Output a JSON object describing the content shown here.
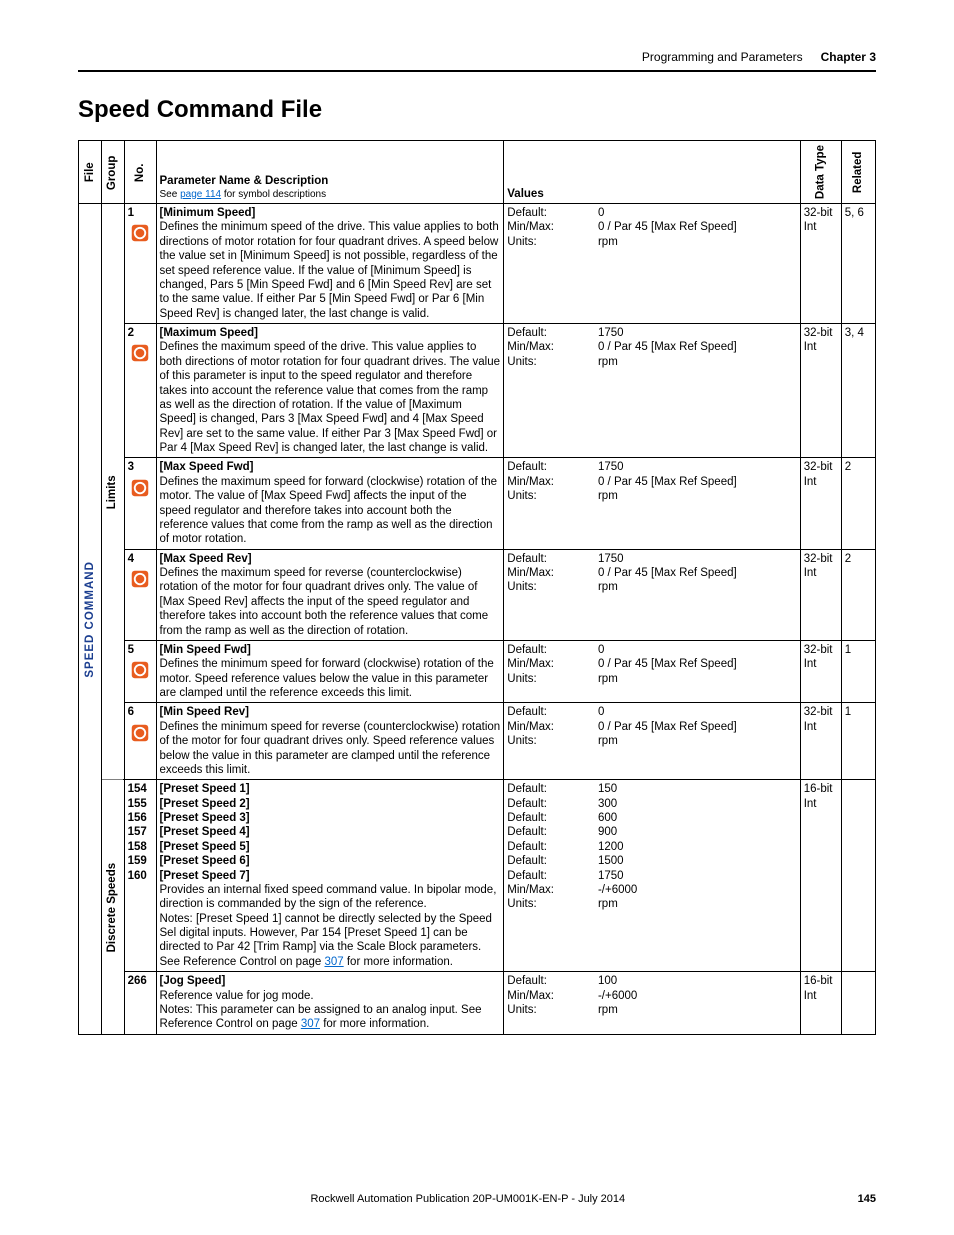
{
  "header": {
    "chapterTitle": "Programming and Parameters",
    "chapterLabel": "Chapter 3"
  },
  "sectionTitle": "Speed Command File",
  "tableHeaders": {
    "file": "File",
    "group": "Group",
    "no": "No.",
    "paramName": "Parameter Name & Description",
    "paramSubPrefix": "See ",
    "paramSubLink": "page 114",
    "paramSubSuffix": " for symbol descriptions",
    "values": "Values",
    "dataType": "Data Type",
    "related": "Related"
  },
  "fileLabel": "SPEED COMMAND",
  "groups": {
    "limits": "Limits",
    "discreteSpeeds": "Discrete Speeds"
  },
  "rows": [
    {
      "no": "1",
      "name": "[Minimum Speed]",
      "desc": "Defines the minimum speed of the drive. This value applies to both directions of motor rotation for four quadrant drives. A speed below the value set in [Minimum Speed] is not possible, regardless of the set speed reference value. If the value of [Minimum Speed] is changed, Pars 5 [Min Speed Fwd] and 6 [Min Speed Rev] are set to the same value. If either Par 5 [Min Speed Fwd] or Par 6 [Min Speed Rev] is changed later, the last change is valid.",
      "vlabels": "Default:\nMin/Max:\nUnits:",
      "vvalues": "0\n0 / Par 45 [Max Ref Speed]\nrpm",
      "dataType": "32-bit Int",
      "related": "5, 6",
      "icon": true
    },
    {
      "no": "2",
      "name": "[Maximum Speed]",
      "desc": "Defines the maximum speed of the drive. This value applies to both directions of motor rotation for four quadrant drives. The value of this parameter is input to the speed regulator and therefore takes into account the reference value that comes from the ramp as well as the direction of rotation. If the value of [Maximum Speed] is changed, Pars 3 [Max Speed Fwd] and 4 [Max Speed Rev] are set to the same value. If either Par 3 [Max Speed Fwd] or Par 4 [Max Speed Rev] is changed later, the last change is valid.",
      "vlabels": "Default:\nMin/Max:\nUnits:",
      "vvalues": "1750\n0 / Par 45 [Max Ref Speed]\nrpm",
      "dataType": "32-bit Int",
      "related": "3, 4",
      "icon": true
    },
    {
      "no": "3",
      "name": "[Max Speed Fwd]",
      "desc": "Defines the maximum speed for forward (clockwise) rotation of the motor. The value of [Max Speed Fwd] affects the input of the speed regulator and therefore takes into account both the reference values that come from the ramp as well as the direction of motor rotation.",
      "vlabels": "Default:\nMin/Max:\nUnits:",
      "vvalues": "1750\n0 / Par 45 [Max Ref Speed]\nrpm",
      "dataType": "32-bit Int",
      "related": "2",
      "icon": true
    },
    {
      "no": "4",
      "name": "[Max Speed Rev]",
      "desc": "Defines the maximum speed for reverse (counterclockwise) rotation of the motor for four quadrant drives only. The value of [Max Speed Rev] affects the input of the speed regulator and therefore takes into account both the reference values that come from the ramp as well as the direction of rotation.",
      "vlabels": "Default:\nMin/Max:\nUnits:",
      "vvalues": "1750\n0 / Par 45 [Max Ref Speed]\nrpm",
      "dataType": "32-bit Int",
      "related": "2",
      "icon": true
    },
    {
      "no": "5",
      "name": "[Min Speed Fwd]",
      "desc": "Defines the minimum speed for forward (clockwise) rotation of the motor. Speed reference values below the value in this parameter are clamped until the reference exceeds this limit.",
      "vlabels": "Default:\nMin/Max:\nUnits:",
      "vvalues": "0\n0 / Par 45 [Max Ref Speed]\nrpm",
      "dataType": "32-bit Int",
      "related": "1",
      "icon": true
    },
    {
      "no": "6",
      "name": "[Min Speed Rev]",
      "desc": "Defines the minimum speed for reverse (counterclockwise) rotation of the motor for four quadrant drives only. Speed reference values below the value in this parameter are clamped until the reference exceeds this limit.",
      "vlabels": "Default:\nMin/Max:\nUnits:",
      "vvalues": "0\n0 / Par 45 [Max Ref Speed]\nrpm",
      "dataType": "32-bit Int",
      "related": "1",
      "icon": true
    },
    {
      "no": "154\n155\n156\n157\n158\n159\n160",
      "name": "[Preset Speed 1]\n[Preset Speed 2]\n[Preset Speed 3]\n[Preset Speed 4]\n[Preset Speed 5]\n[Preset Speed 6]\n[Preset Speed 7]",
      "descPrefix": "Provides an internal fixed speed command value. In bipolar mode, direction is commanded by the sign of the reference.\nNotes: [Preset Speed 1] cannot be directly selected by the Speed Sel digital inputs. However, Par 154 [Preset Speed 1] can be directed to Par 42 [Trim Ramp] via the Scale Block parameters. See Reference Control on page ",
      "descLink": "307",
      "descSuffix": " for more information.",
      "vlabels": "Default:\nDefault:\nDefault:\nDefault:\nDefault:\nDefault:\nDefault:\nMin/Max:\nUnits:",
      "vvalues": "150\n300\n600\n900\n1200\n1500\n1750\n-/+6000\nrpm",
      "dataType": "16-bit Int",
      "related": "",
      "icon": false
    },
    {
      "no": "266",
      "name": "[Jog Speed]",
      "descPrefix": "Reference value for jog mode.\nNotes: This parameter can be assigned to an analog input. See Reference Control on page ",
      "descLink": "307",
      "descSuffix": " for more information.",
      "vlabels": "Default:\nMin/Max:\nUnits:",
      "vvalues": "100\n-/+6000\nrpm",
      "dataType": "16-bit Int",
      "related": "",
      "icon": false
    }
  ],
  "footer": {
    "pub": "Rockwell Automation Publication 20P-UM001K-EN-P - July 2014",
    "page": "145"
  }
}
